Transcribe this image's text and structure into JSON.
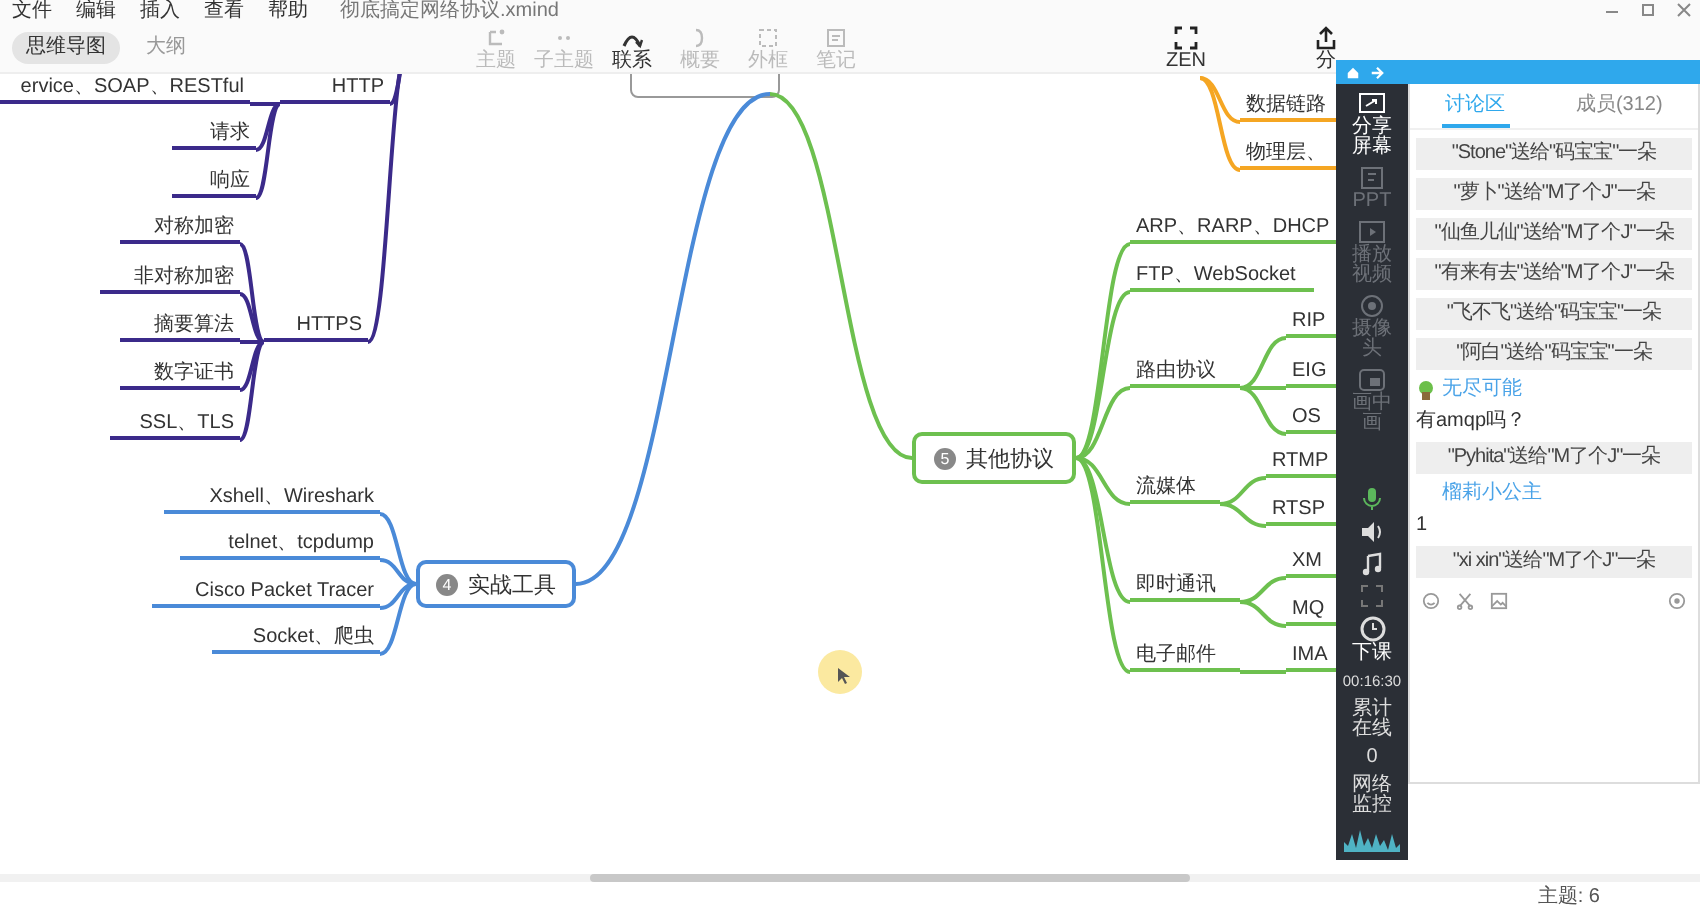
{
  "menu": [
    "文件",
    "编辑",
    "插入",
    "查看",
    "帮助"
  ],
  "file_name": "彻底搞定网络协议.xmind",
  "view_tabs": [
    {
      "label": "思维导图",
      "selected": true
    },
    {
      "label": "大纲",
      "selected": false
    }
  ],
  "tools": [
    {
      "label": "主题",
      "kind": "topic",
      "disabled": true
    },
    {
      "label": "子主题",
      "kind": "subtopic",
      "disabled": true
    },
    {
      "label": "联系",
      "kind": "relation",
      "disabled": false
    },
    {
      "label": "概要",
      "kind": "summary",
      "disabled": true
    },
    {
      "label": "外框",
      "kind": "boundary",
      "disabled": true
    },
    {
      "label": "笔记",
      "kind": "note",
      "disabled": true
    }
  ],
  "zen": {
    "label": "ZEN"
  },
  "share": {
    "label": "分"
  },
  "mind_map": {
    "branches": [
      {
        "kind": "line",
        "label": "HTTP",
        "color": "#3b2a8a",
        "children": [
          {
            "label": "ervice、SOAP、RESTful"
          },
          {
            "label": "请求"
          },
          {
            "label": "响应"
          }
        ]
      },
      {
        "kind": "line",
        "label": "HTTPS",
        "color": "#3b2a8a",
        "children": [
          {
            "label": "对称加密"
          },
          {
            "label": "非对称加密"
          },
          {
            "label": "摘要算法"
          },
          {
            "label": "数字证书"
          },
          {
            "label": "SSL、TLS"
          }
        ]
      },
      {
        "kind": "box",
        "marker": "4",
        "label": "实战工具",
        "color": "#4a8ad8",
        "children": [
          {
            "label": "Xshell、Wireshark"
          },
          {
            "label": "telnet、tcpdump"
          },
          {
            "label": "Cisco Packet Tracer"
          },
          {
            "label": "Socket、爬虫"
          }
        ]
      },
      {
        "kind": "line",
        "color": "#f5a623",
        "children": [
          {
            "label": "数据链路"
          },
          {
            "label": "物理层、"
          }
        ]
      },
      {
        "kind": "box",
        "marker": "5",
        "label": "其他协议",
        "color": "#6dc04f",
        "children": [
          {
            "label": "ARP、RARP、DHCP"
          },
          {
            "label": "FTP、WebSocket"
          },
          {
            "label": "路由协议",
            "children": [
              {
                "label": "RIP"
              },
              {
                "label": "EIG"
              },
              {
                "label": "OS"
              }
            ]
          },
          {
            "label": "流媒体",
            "children": [
              {
                "label": "RTMP"
              },
              {
                "label": "RTSP"
              }
            ]
          },
          {
            "label": "即时通讯",
            "children": [
              {
                "label": "XM"
              },
              {
                "label": "MQ"
              }
            ]
          },
          {
            "label": "电子邮件",
            "children": [
              {
                "label": "IMA"
              }
            ]
          }
        ]
      }
    ]
  },
  "class_panel": {
    "sidebar": [
      {
        "label": "分享屏幕",
        "kind": "share",
        "selected": true
      },
      {
        "label": "PPT",
        "kind": "ppt",
        "selected": false
      },
      {
        "label": "播放视频",
        "kind": "video",
        "selected": false
      },
      {
        "label": "摄像头",
        "kind": "camera",
        "selected": false
      },
      {
        "label": "画中画",
        "kind": "board",
        "selected": false
      }
    ],
    "end_class": "下课",
    "timer": "00:16:30",
    "online_label": "累计在线",
    "online_count": "0",
    "network_label": "网络监控",
    "tabs": [
      {
        "label": "讨论区",
        "selected": true
      },
      {
        "label": "成员(312)",
        "selected": false
      }
    ],
    "messages": [
      {
        "kind": "gift",
        "text": "\"Stone\"送给\"码宝宝\"一朵"
      },
      {
        "kind": "gift",
        "text": "\"萝卜\"送给\"M了个J\"一朵"
      },
      {
        "kind": "gift",
        "text": "\"仙鱼儿仙\"送给\"M了个J\"一朵"
      },
      {
        "kind": "gift",
        "text": "\"有来有去\"送给\"M了个J\"一朵"
      },
      {
        "kind": "gift",
        "text": "\"飞不飞\"送给\"码宝宝\"一朵"
      },
      {
        "kind": "gift",
        "text": "\"阿白\"送给\"码宝宝\"一朵"
      },
      {
        "kind": "chat",
        "avatar": true,
        "user": "无尽可能",
        "text": "有amqp吗？"
      },
      {
        "kind": "gift",
        "text": "\"Pyhita\"送给\"M了个J\"一朵"
      },
      {
        "kind": "chat",
        "avatar": false,
        "user": "榴莉小公主",
        "text": "1"
      },
      {
        "kind": "gift",
        "text": "\"xi xin\"送给\"M了个J\"一朵"
      }
    ]
  },
  "status_bar": {
    "topics": "主题: 6"
  }
}
